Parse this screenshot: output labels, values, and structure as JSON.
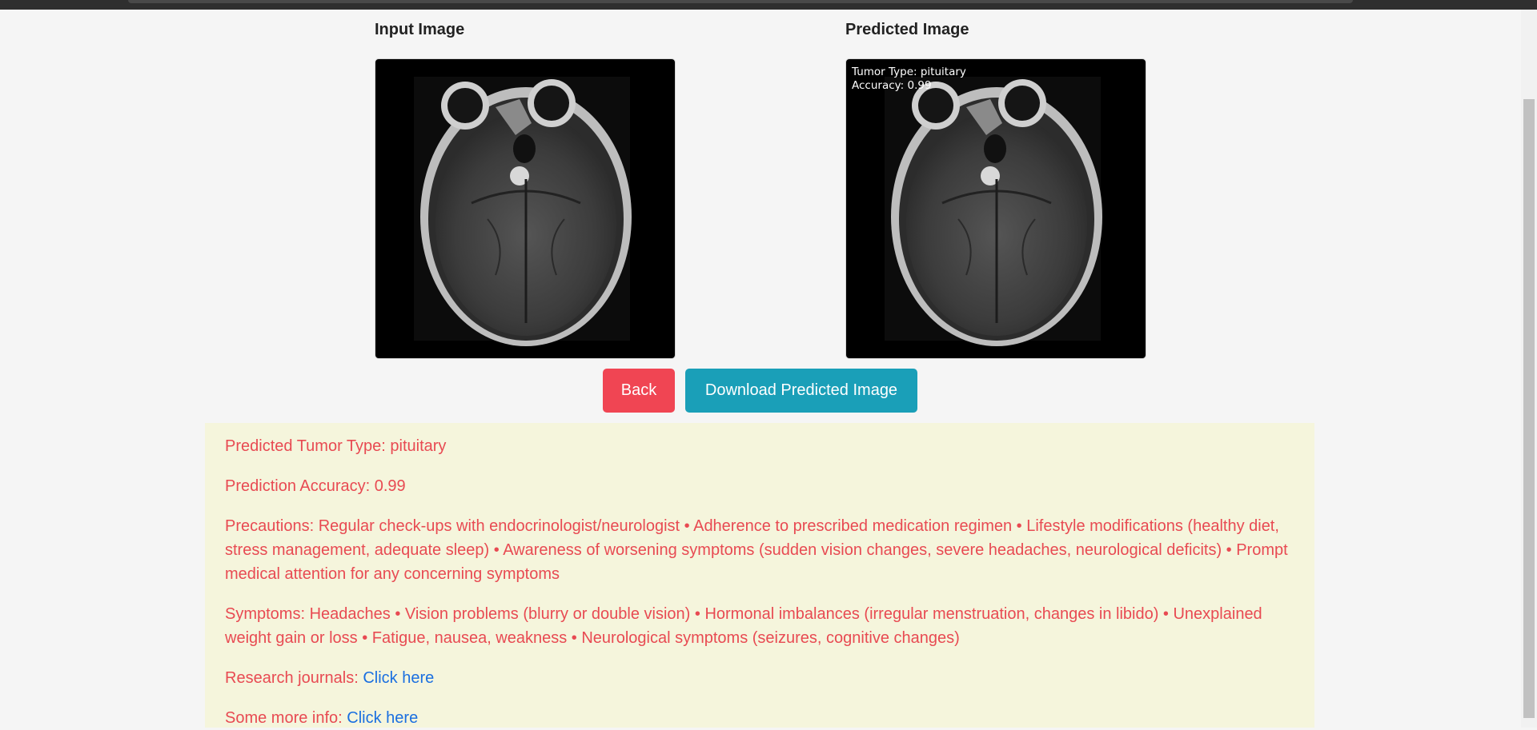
{
  "input_section": {
    "title": "Input Image"
  },
  "predicted_section": {
    "title": "Predicted Image",
    "overlay_line1": "Tumor Type: pituitary",
    "overlay_line2": "Accuracy: 0.99"
  },
  "buttons": {
    "back_label": "Back",
    "download_label": "Download Predicted Image"
  },
  "results": {
    "tumor_type": "Predicted Tumor Type: pituitary",
    "accuracy": "Prediction Accuracy: 0.99",
    "precautions": "Precautions: Regular check-ups with endocrinologist/neurologist • Adherence to prescribed medication regimen • Lifestyle modifications (healthy diet, stress management, adequate sleep) • Awareness of worsening symptoms (sudden vision changes, severe headaches, neurological deficits) • Prompt medical attention for any concerning symptoms",
    "symptoms": "Symptoms: Headaches • Vision problems (blurry or double vision) • Hormonal imbalances (irregular menstruation, changes in libido) • Unexplained weight gain or loss • Fatigue, nausea, weakness • Neurological symptoms (seizures, cognitive changes)",
    "research_label": "Research journals: ",
    "research_link": "Click here",
    "more_info_label": "Some more info: ",
    "more_info_link": "Click here"
  },
  "colors": {
    "background": "#f5f5f5",
    "back_button": "#f04553",
    "download_button": "#1a9fb8",
    "info_panel": "#f5f5dc",
    "info_text": "#e84a52",
    "link": "#1a6fe0"
  }
}
